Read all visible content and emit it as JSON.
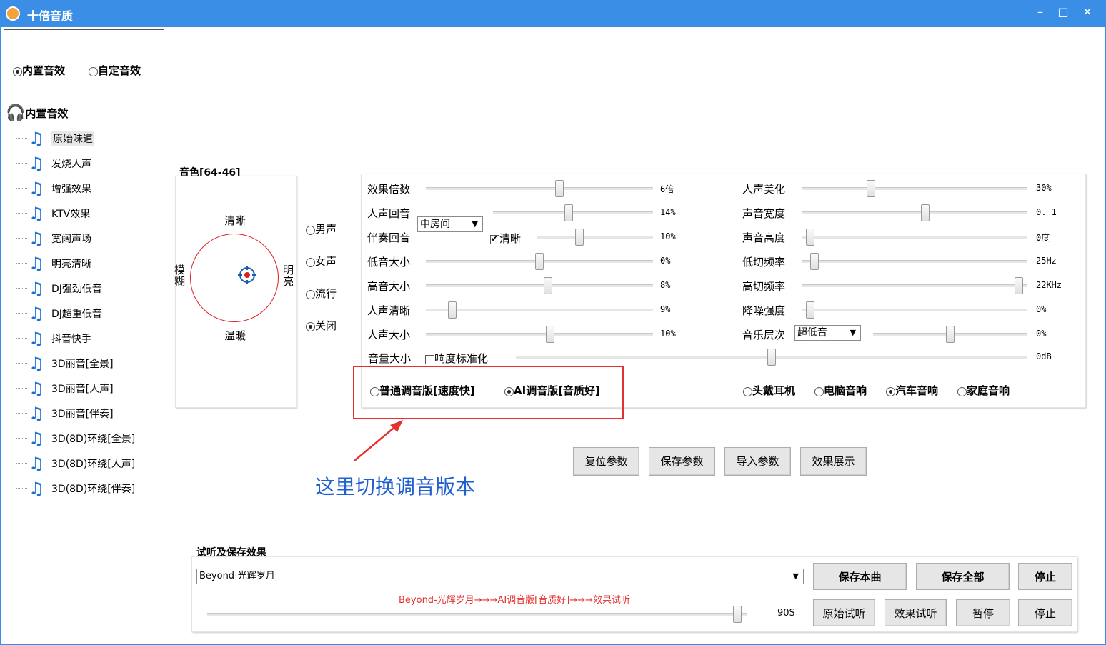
{
  "window": {
    "title": "十倍音质",
    "minimize": "–",
    "maximize": "□",
    "close": "✕"
  },
  "effect_mode": {
    "builtin": "内置音效",
    "custom": "自定音效"
  },
  "tree": {
    "root": "内置音效",
    "items": [
      "原始味道",
      "发烧人声",
      "增强效果",
      "KTV效果",
      "宽阔声场",
      "明亮清晰",
      "DJ强劲低音",
      "DJ超重低音",
      "抖音快手",
      "3D丽音[全景]",
      "3D丽音[人声]",
      "3D丽音[伴奏]",
      "3D(8D)环绕[全景]",
      "3D(8D)环绕[人声]",
      "3D(8D)环绕[伴奏]"
    ]
  },
  "timbre": {
    "title": "音色[64-46]",
    "top": "清晰",
    "bottom": "温暖",
    "left": "模糊",
    "right": "明亮"
  },
  "voice": {
    "male": "男声",
    "female": "女声",
    "pop": "流行",
    "off": "关闭"
  },
  "params_left": [
    {
      "label": "效果倍数",
      "value": "6倍",
      "level": 0.59
    },
    {
      "label": "人声回音",
      "value": "14%",
      "level": 0.47
    },
    {
      "label": "伴奏回音",
      "value": "10%",
      "level": 0.35
    },
    {
      "label": "低音大小",
      "value": "0%",
      "level": 0.5
    },
    {
      "label": "高音大小",
      "value": "8%",
      "level": 0.54
    },
    {
      "label": "人声清晰",
      "value": "9%",
      "level": 0.1
    },
    {
      "label": "人声大小",
      "value": "10%",
      "level": 0.55
    }
  ],
  "params_right": [
    {
      "label": "人声美化",
      "value": "30%",
      "level": 0.3
    },
    {
      "label": "声音宽度",
      "value": "0. 1",
      "level": 0.55
    },
    {
      "label": "声音高度",
      "value": "0度",
      "level": 0.02
    },
    {
      "label": "低切频率",
      "value": "25Hz",
      "level": 0.04
    },
    {
      "label": "高切频率",
      "value": "22KHz",
      "level": 0.98
    },
    {
      "label": "降噪强度",
      "value": "0%",
      "level": 0.02
    },
    {
      "label": "音乐层次",
      "value": "0%",
      "level": 0.5
    }
  ],
  "echo_room": "中房间",
  "clear_label": "清晰",
  "music_layer": "超低音",
  "volume": {
    "label": "音量大小",
    "normalize": "响度标准化",
    "value": "0dB",
    "level": 0.5
  },
  "versions": {
    "normal": "普通调音版[速度快]",
    "ai": "AI调音版[音质好]"
  },
  "devices": {
    "headphone": "头戴耳机",
    "pc": "电脑音响",
    "car": "汽车音响",
    "home": "家庭音响"
  },
  "buttons": {
    "reset": "复位参数",
    "save": "保存参数",
    "import": "导入参数",
    "demo": "效果展示"
  },
  "annotation": "这里切换调音版本",
  "audition": {
    "title": "试听及保存效果",
    "song": "Beyond-光辉岁月",
    "status": "Beyond-光辉岁月→→→AI调音版[音质好]→→→效果试听",
    "duration": "90S",
    "progress": 0.99,
    "save_song": "保存本曲",
    "save_all": "保存全部",
    "stop1": "停止",
    "original": "原始试听",
    "effect": "效果试听",
    "pause": "暂停",
    "stop2": "停止"
  },
  "colors": {
    "titlebar": "#3a8ee6",
    "accent_red": "#e53030",
    "annotation": "#1f5fd0"
  }
}
